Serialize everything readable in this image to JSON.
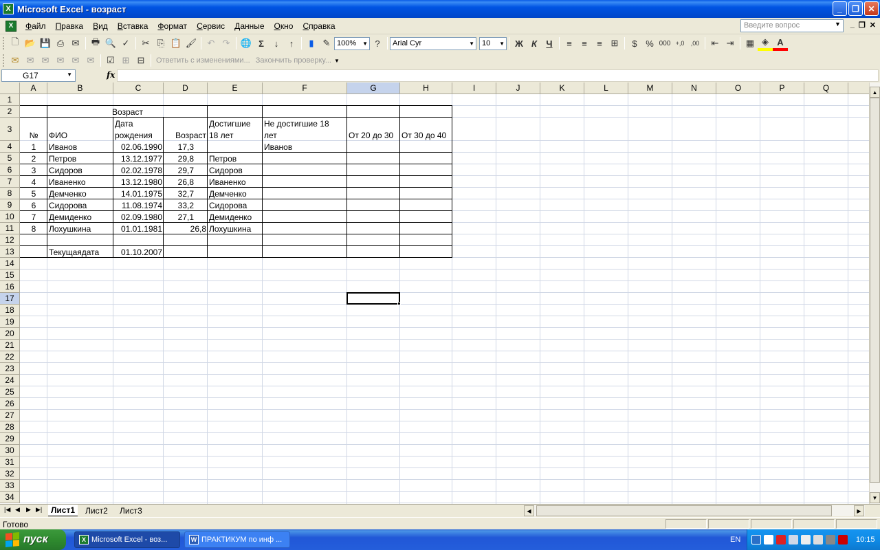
{
  "window": {
    "title": "Microsoft Excel - возраст",
    "app_icon": "excel-icon"
  },
  "menu": {
    "items": [
      "Файл",
      "Правка",
      "Вид",
      "Вставка",
      "Формат",
      "Сервис",
      "Данные",
      "Окно",
      "Справка"
    ],
    "help_placeholder": "Введите вопрос"
  },
  "toolbar": {
    "zoom": "100%",
    "font_name": "Arial Cyr",
    "font_size": "10",
    "bold": "Ж",
    "italic": "К",
    "underline": "Ч",
    "reply_with_changes": "Ответить с изменениями...",
    "end_review": "Закончить проверку...",
    "accent_fill": "#ffff00",
    "accent_font": "#ff0000"
  },
  "formula_bar": {
    "name_box": "G17",
    "fx": "fx",
    "content": ""
  },
  "columns": [
    "A",
    "B",
    "C",
    "D",
    "E",
    "F",
    "G",
    "H",
    "I",
    "J",
    "K",
    "L",
    "M",
    "N",
    "O",
    "P",
    "Q"
  ],
  "rows": [
    "1",
    "2",
    "3",
    "4",
    "5",
    "6",
    "7",
    "8",
    "9",
    "10",
    "11",
    "12",
    "13",
    "14",
    "15",
    "16",
    "17",
    "18",
    "19",
    "20",
    "21",
    "22",
    "23",
    "24",
    "25",
    "26",
    "27",
    "28",
    "29",
    "30",
    "31",
    "32",
    "33",
    "34"
  ],
  "active_cell": {
    "col": "G",
    "row": "17"
  },
  "sheet": {
    "title": "Возраст",
    "headers": {
      "num": "№",
      "fio": "ФИО",
      "dob_line1": "Дата",
      "dob_line2": "рождения",
      "age": "Возраст",
      "adult_line1": "Достигшие",
      "adult_line2": "18 лет",
      "minor_line1": "Не достигшие 18",
      "minor_line2": "лет",
      "g": "От 20 до 30",
      "h": "От 30 до 40"
    },
    "records": [
      {
        "n": "1",
        "fio": "Иванов",
        "dob": "02.06.1990",
        "age": "17,3",
        "adult": "",
        "minor": "Иванов"
      },
      {
        "n": "2",
        "fio": "Петров",
        "dob": "13.12.1977",
        "age": "29,8",
        "adult": "Петров",
        "minor": ""
      },
      {
        "n": "3",
        "fio": "Сидоров",
        "dob": "02.02.1978",
        "age": "29,7",
        "adult": "Сидоров",
        "minor": ""
      },
      {
        "n": "4",
        "fio": "Иваненко",
        "dob": "13.12.1980",
        "age": "26,8",
        "adult": "Иваненко",
        "minor": ""
      },
      {
        "n": "5",
        "fio": "Демченко",
        "dob": "14.01.1975",
        "age": "32,7",
        "adult": "Демченко",
        "minor": ""
      },
      {
        "n": "6",
        "fio": "Сидорова",
        "dob": "11.08.1974",
        "age": "33,2",
        "adult": "Сидорова",
        "minor": ""
      },
      {
        "n": "7",
        "fio": "Демиденко",
        "dob": "02.09.1980",
        "age": "27,1",
        "adult": "Демиденко",
        "minor": ""
      },
      {
        "n": "8",
        "fio": "Лохушкина",
        "dob": "01.01.1981",
        "age": "26,8",
        "adult": "Лохушкина",
        "minor": ""
      }
    ],
    "current_date_label": "Текущаядата",
    "current_date": "01.10.2007"
  },
  "tabs": [
    "Лист1",
    "Лист2",
    "Лист3"
  ],
  "status": "Готово",
  "taskbar": {
    "start": "пуск",
    "tasks": [
      "Microsoft Excel - воз...",
      "ПРАКТИКУМ по инф ..."
    ],
    "lang": "EN",
    "clock": "10:15"
  }
}
